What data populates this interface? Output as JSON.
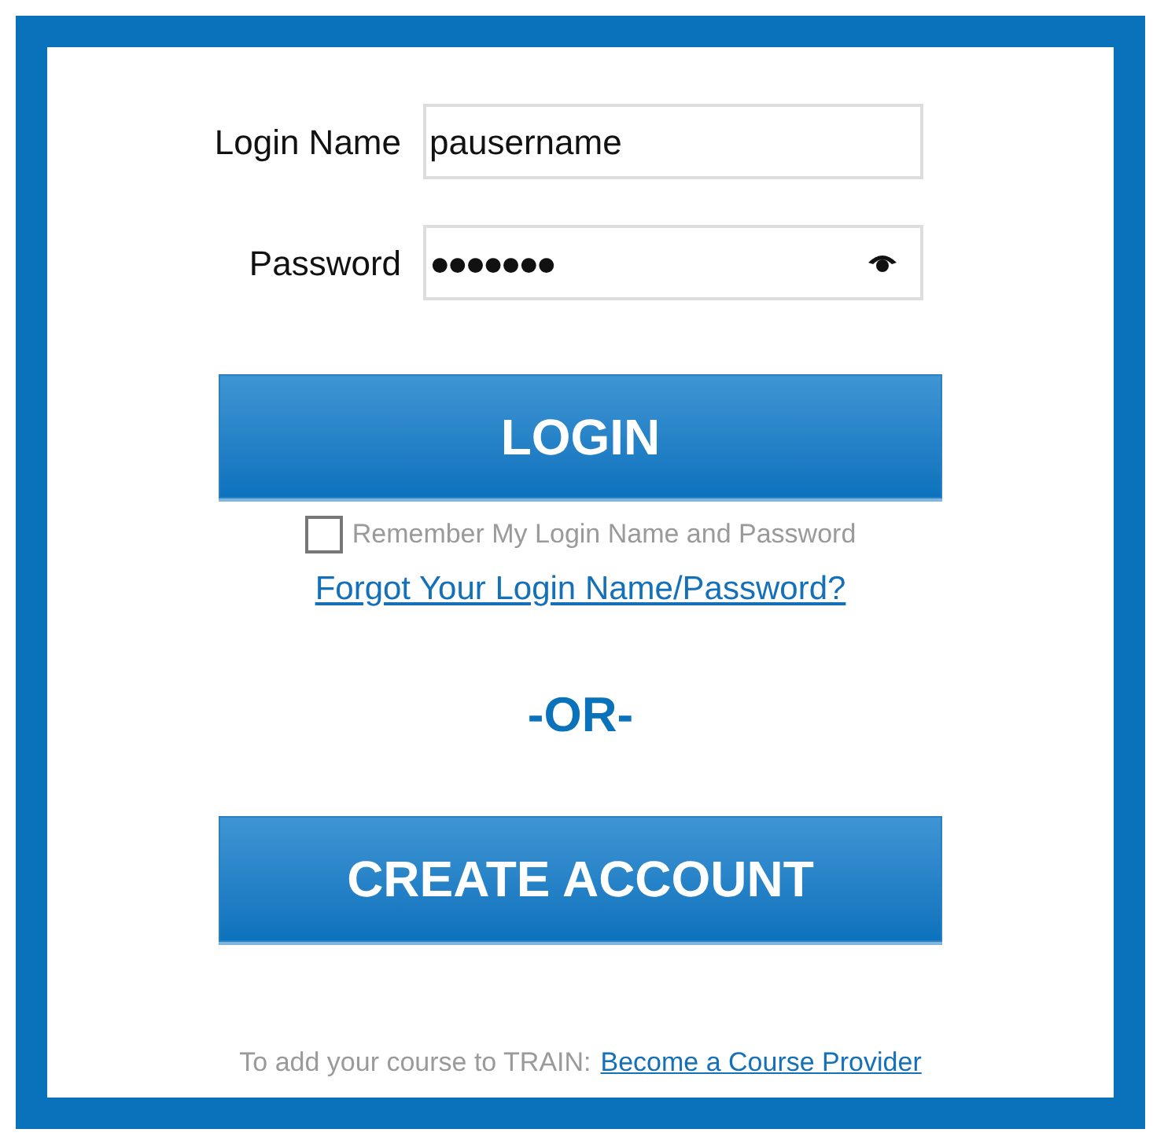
{
  "fields": [
    {
      "label": "Login Name",
      "value": "pausername",
      "kind": "text"
    },
    {
      "label": "Password",
      "value": "●●●●●●●",
      "kind": "password"
    }
  ],
  "login_button": "LOGIN",
  "remember": {
    "label": "Remember My Login Name and Password",
    "checked": false
  },
  "forgot_link": "Forgot Your Login Name/Password?",
  "separator": "-OR-",
  "create_button": "CREATE ACCOUNT",
  "footer": {
    "text": "To add your course to TRAIN:",
    "link": "Become a Course Provider"
  }
}
